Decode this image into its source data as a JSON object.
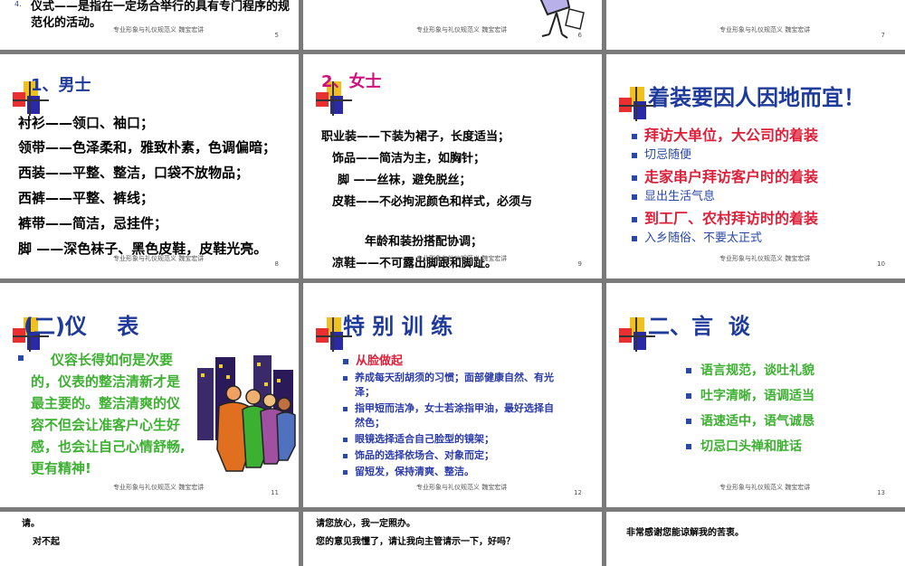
{
  "footer": {
    "text": "专业形象与礼仪规范义",
    "author": "魏宝宏讲"
  },
  "s5": {
    "num": "5",
    "bullet": "4.",
    "line1": "仪式——是指在一定场合举行的具有专门程序的规",
    "line2": "范化的活动。"
  },
  "s6": {
    "num": "6"
  },
  "s7": {
    "num": "7"
  },
  "s8": {
    "num": "8",
    "title": "1、男士",
    "lines": [
      "衬衫——领口、袖口；",
      "领带——色泽柔和，雅致朴素，色调偏暗；",
      "西装——平整、整洁，口袋不放物品；",
      "西裤——平整、裤线；",
      "裤带——简洁，忌挂件；",
      "脚 ——深色袜子、黑色皮鞋，皮鞋光亮。"
    ]
  },
  "s9": {
    "num": "9",
    "title": "2、女士",
    "lines": [
      "职业装——下装为裙子，长度适当；",
      "饰品——简洁为主，如胸针；",
      "脚 ——丝袜，避免脱丝；",
      "皮鞋——不必拘泥颜色和样式，必须与",
      "年龄和装扮搭配协调；",
      "凉鞋——不可露出脚跟和脚趾。"
    ]
  },
  "s10": {
    "num": "10",
    "title": "着装要因人因地而宜！",
    "items": [
      "拜访大单位，大公司的着装",
      "切忌随便",
      "走家串户拜访客户时的着装",
      "显出生活气息",
      "到工厂、农村拜访时的着装",
      "入乡随俗、不要太正式"
    ]
  },
  "s11": {
    "num": "11",
    "title": "(二)仪    表",
    "lines": [
      "仪容长得如何是次要",
      "的，仪表的整洁清新才是",
      "最主要的。整洁清爽的仪",
      "容不但会让准客户心生好",
      "感，也会让自己心情舒畅,",
      "更有精神!"
    ]
  },
  "s12": {
    "num": "12",
    "title": "特 别 训 练",
    "head": "从脸做起",
    "items": [
      "养成每天刮胡须的习惯；面部健康自然、有光",
      "泽；",
      "指甲短而洁净，女士若涂指甲油，最好选择自",
      "然色；",
      "眼镜选择适合自己脸型的镜架；",
      "饰品的选择依场合、对象而定；",
      "留短发，保持清爽、整洁。"
    ]
  },
  "s13": {
    "num": "13",
    "title": "二、言  谈",
    "items": [
      "语言规范，谈吐礼貌",
      "吐字清晰，语调适当",
      "语速适中，语气诚恳",
      "切忌口头禅和脏话"
    ]
  },
  "s14": {
    "l1": "请。",
    "l2": "对不起"
  },
  "s15": {
    "l1": "请您放心，我一定照办。",
    "l2": "您的意见我懂了，请让我向主管请示一下，好吗？"
  },
  "s16": {
    "l1": "非常感谢您能谅解我的苦衷。"
  },
  "colors": {
    "blue_title": "#1e3a9a",
    "red": "#e0203a",
    "green": "#3cb030",
    "magenta": "#d0107a"
  }
}
